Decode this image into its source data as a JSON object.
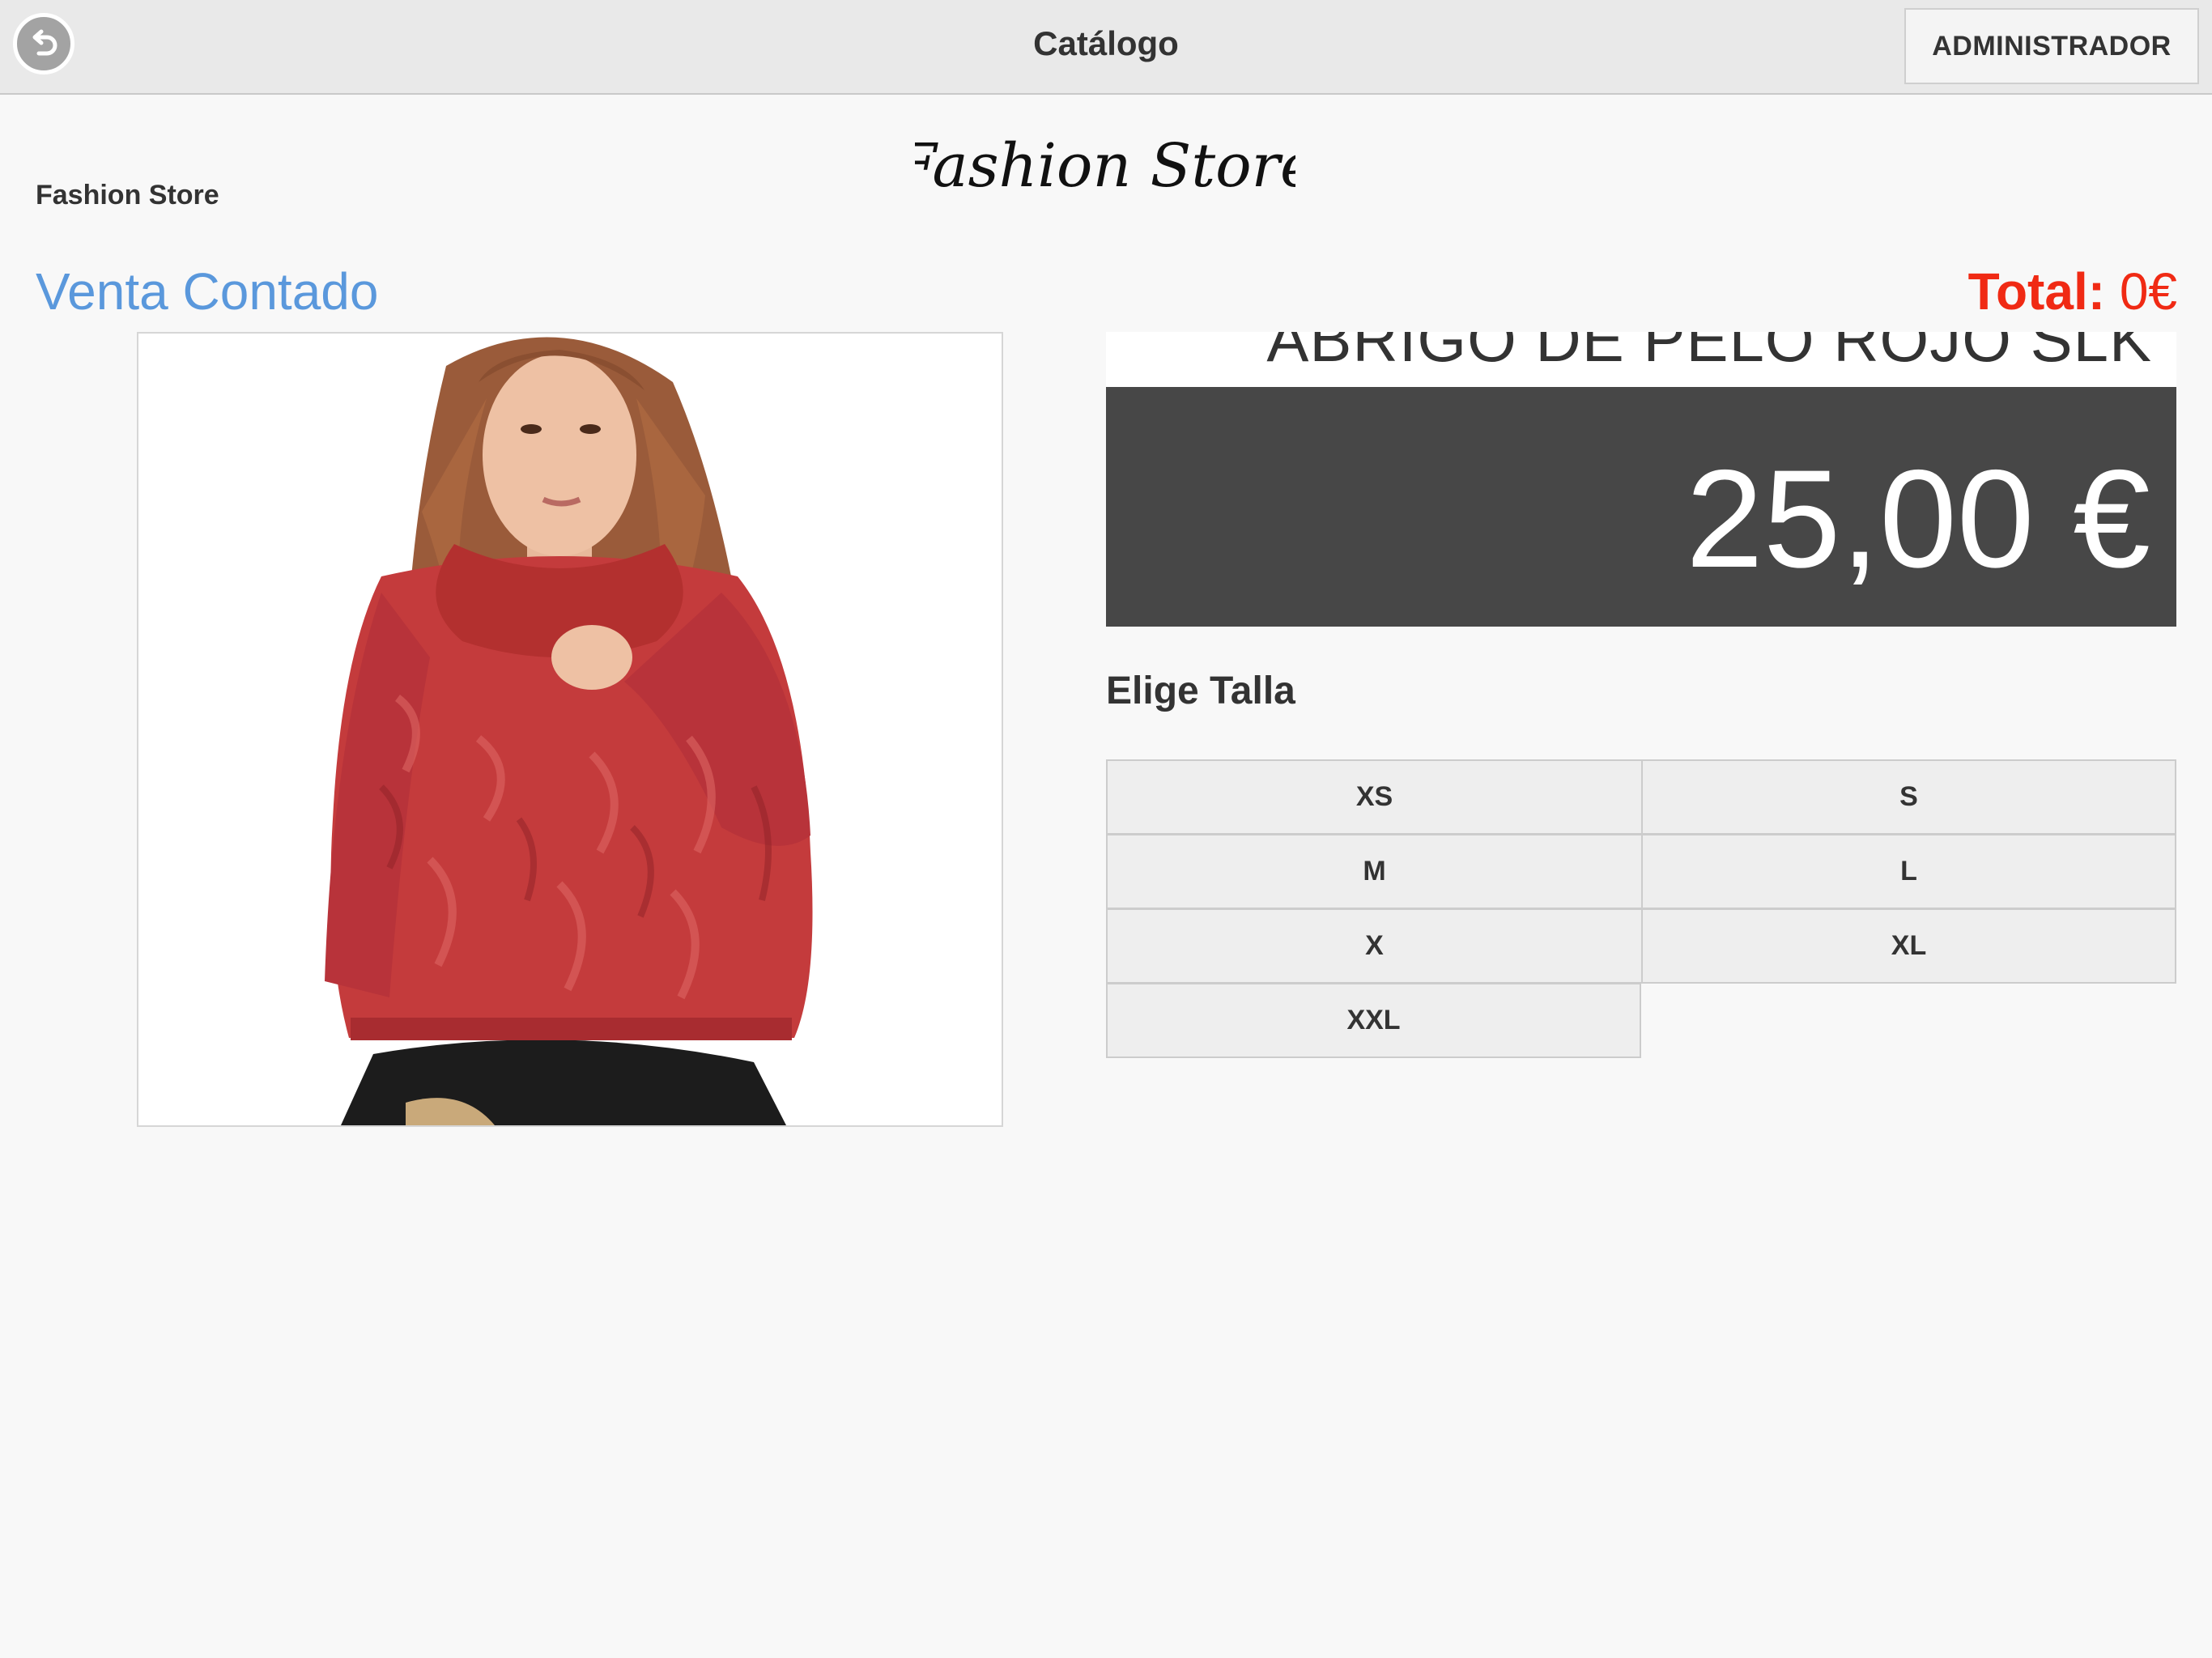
{
  "nav": {
    "title": "Catálogo",
    "admin_label": "ADMINISTRADOR"
  },
  "header": {
    "store_name": "Fashion Store",
    "logo_text": "Fashion Store"
  },
  "sale": {
    "mode_label": "Venta Contado",
    "total_label": "Total:",
    "total_value": "0€"
  },
  "product": {
    "name": "ABRIGO DE PELO ROJO SLK",
    "price": "25,00 €"
  },
  "sizes": {
    "heading": "Elige Talla",
    "options": [
      "XS",
      "S",
      "M",
      "L",
      "X",
      "XL",
      "XXL"
    ]
  },
  "colors": {
    "accent_blue": "#5a98dc",
    "total_red": "#f02a14",
    "price_bg": "#474747",
    "coat_red": "#c43b3c"
  },
  "icons": {
    "back": "undo-arrow-icon"
  }
}
